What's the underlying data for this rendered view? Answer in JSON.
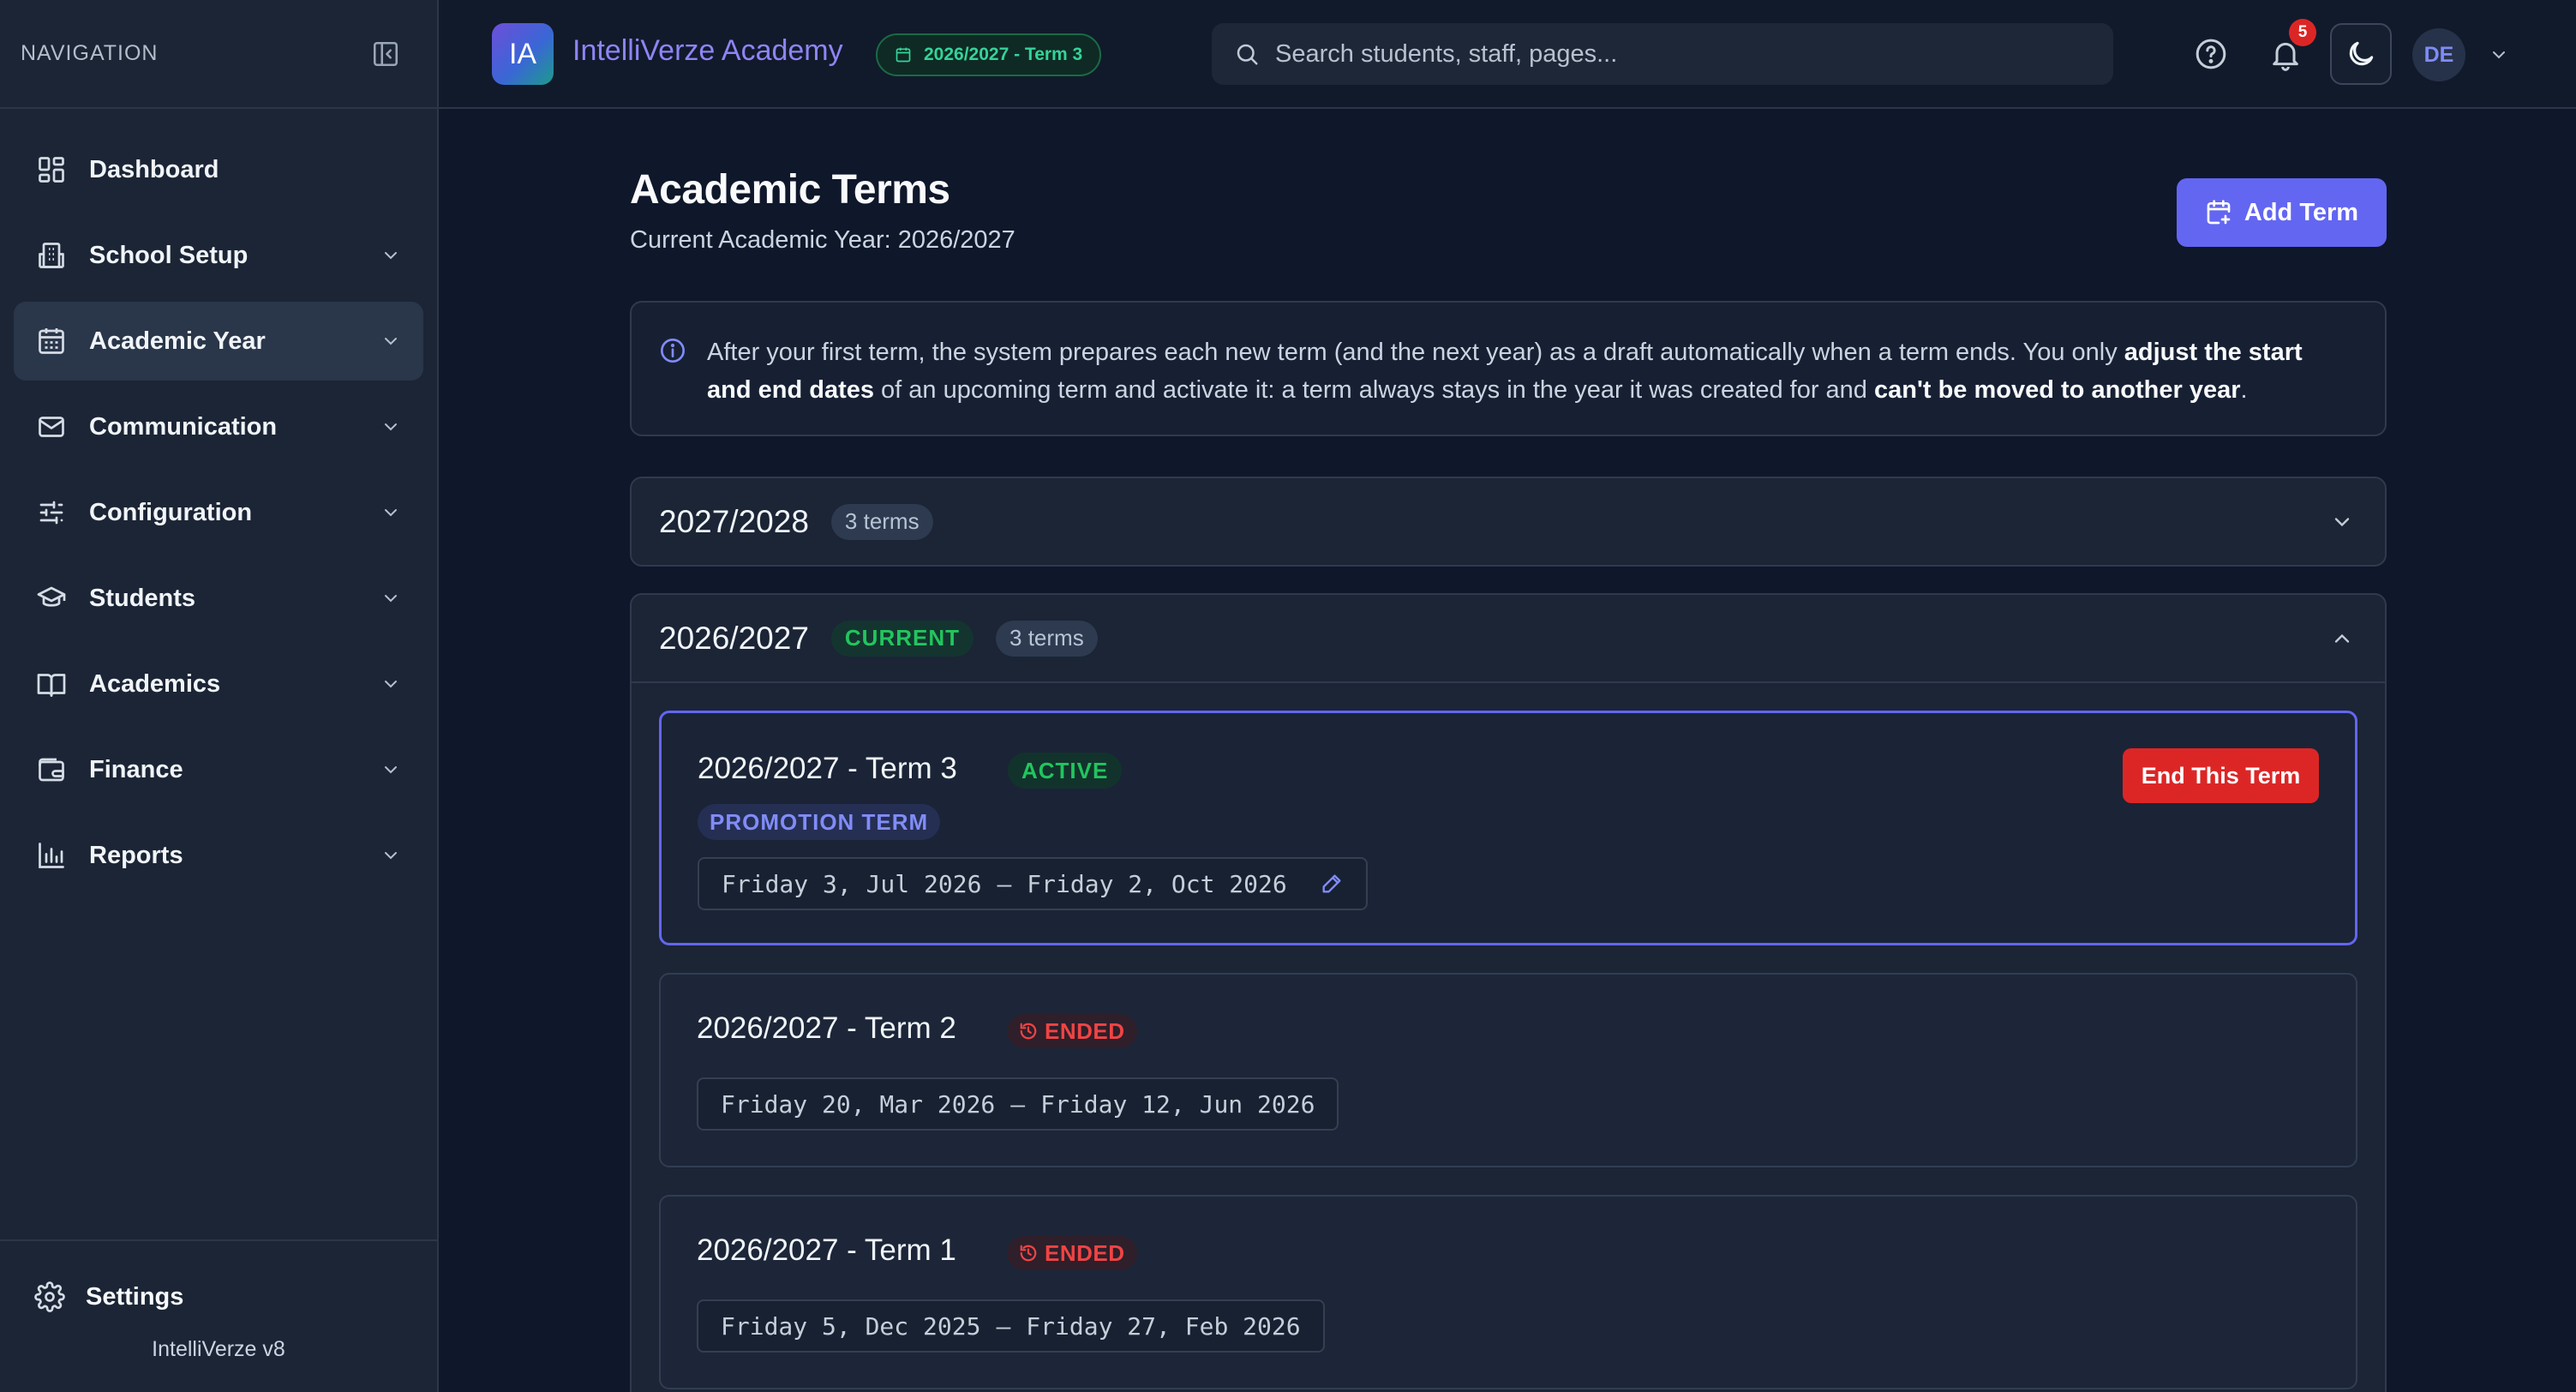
{
  "sidebar": {
    "title": "NAVIGATION",
    "items": [
      {
        "label": "Dashboard"
      },
      {
        "label": "School Setup"
      },
      {
        "label": "Academic Year"
      },
      {
        "label": "Communication"
      },
      {
        "label": "Configuration"
      },
      {
        "label": "Students"
      },
      {
        "label": "Academics"
      },
      {
        "label": "Finance"
      },
      {
        "label": "Reports"
      }
    ],
    "settings_label": "Settings",
    "version": "IntelliVerze v8"
  },
  "topbar": {
    "logo_text": "IA",
    "brand": "IntelliVerze Academy",
    "term_pill": "2026/2027 - Term 3",
    "search_placeholder": "Search students, staff, pages...",
    "notification_count": "5",
    "avatar_initials": "DE"
  },
  "page": {
    "title": "Academic Terms",
    "subtitle": "Current Academic Year: 2026/2027",
    "add_button": "Add Term"
  },
  "info": {
    "text1": "After your first term, the system prepares each new term (and the next year) as a draft automatically when a term ends. You only ",
    "bold1": "adjust the start and end dates",
    "text2": " of an upcoming term and activate it: a term always stays in the year it was created for and ",
    "bold2": "can't be moved to another year",
    "text3": "."
  },
  "years": [
    {
      "name": "2027/2028",
      "terms_count": "3 terms"
    },
    {
      "name": "2026/2027",
      "current_badge": "CURRENT",
      "terms_count": "3 terms",
      "terms": [
        {
          "title": "2026/2027 - Term 3",
          "status": "ACTIVE",
          "promotion": "PROMOTION TERM",
          "start": "Friday 3, Jul 2026",
          "end": "Friday 2, Oct 2026",
          "action": "End This Term"
        },
        {
          "title": "2026/2027 - Term 2",
          "status": "ENDED",
          "start": "Friday 20, Mar 2026",
          "end": "Friday 12, Jun 2026"
        },
        {
          "title": "2026/2027 - Term 1",
          "status": "ENDED",
          "start": "Friday 5, Dec 2025",
          "end": "Friday 27, Feb 2026"
        }
      ]
    }
  ],
  "colors": {
    "accent": "#6366f1",
    "success": "#22c55e",
    "danger": "#dc2626",
    "background": "#0f172a"
  },
  "icons": [
    "collapse-sidebar-icon",
    "dashboard-icon",
    "building-icon",
    "calendar-icon",
    "mail-icon",
    "sliders-icon",
    "graduation-cap-icon",
    "book-icon",
    "wallet-icon",
    "bar-chart-icon",
    "gear-icon",
    "search-icon",
    "help-icon",
    "bell-icon",
    "moon-icon",
    "chevron-down-icon",
    "chevron-up-icon",
    "info-icon",
    "pencil-icon",
    "clock-icon",
    "calendar-plus-icon"
  ]
}
